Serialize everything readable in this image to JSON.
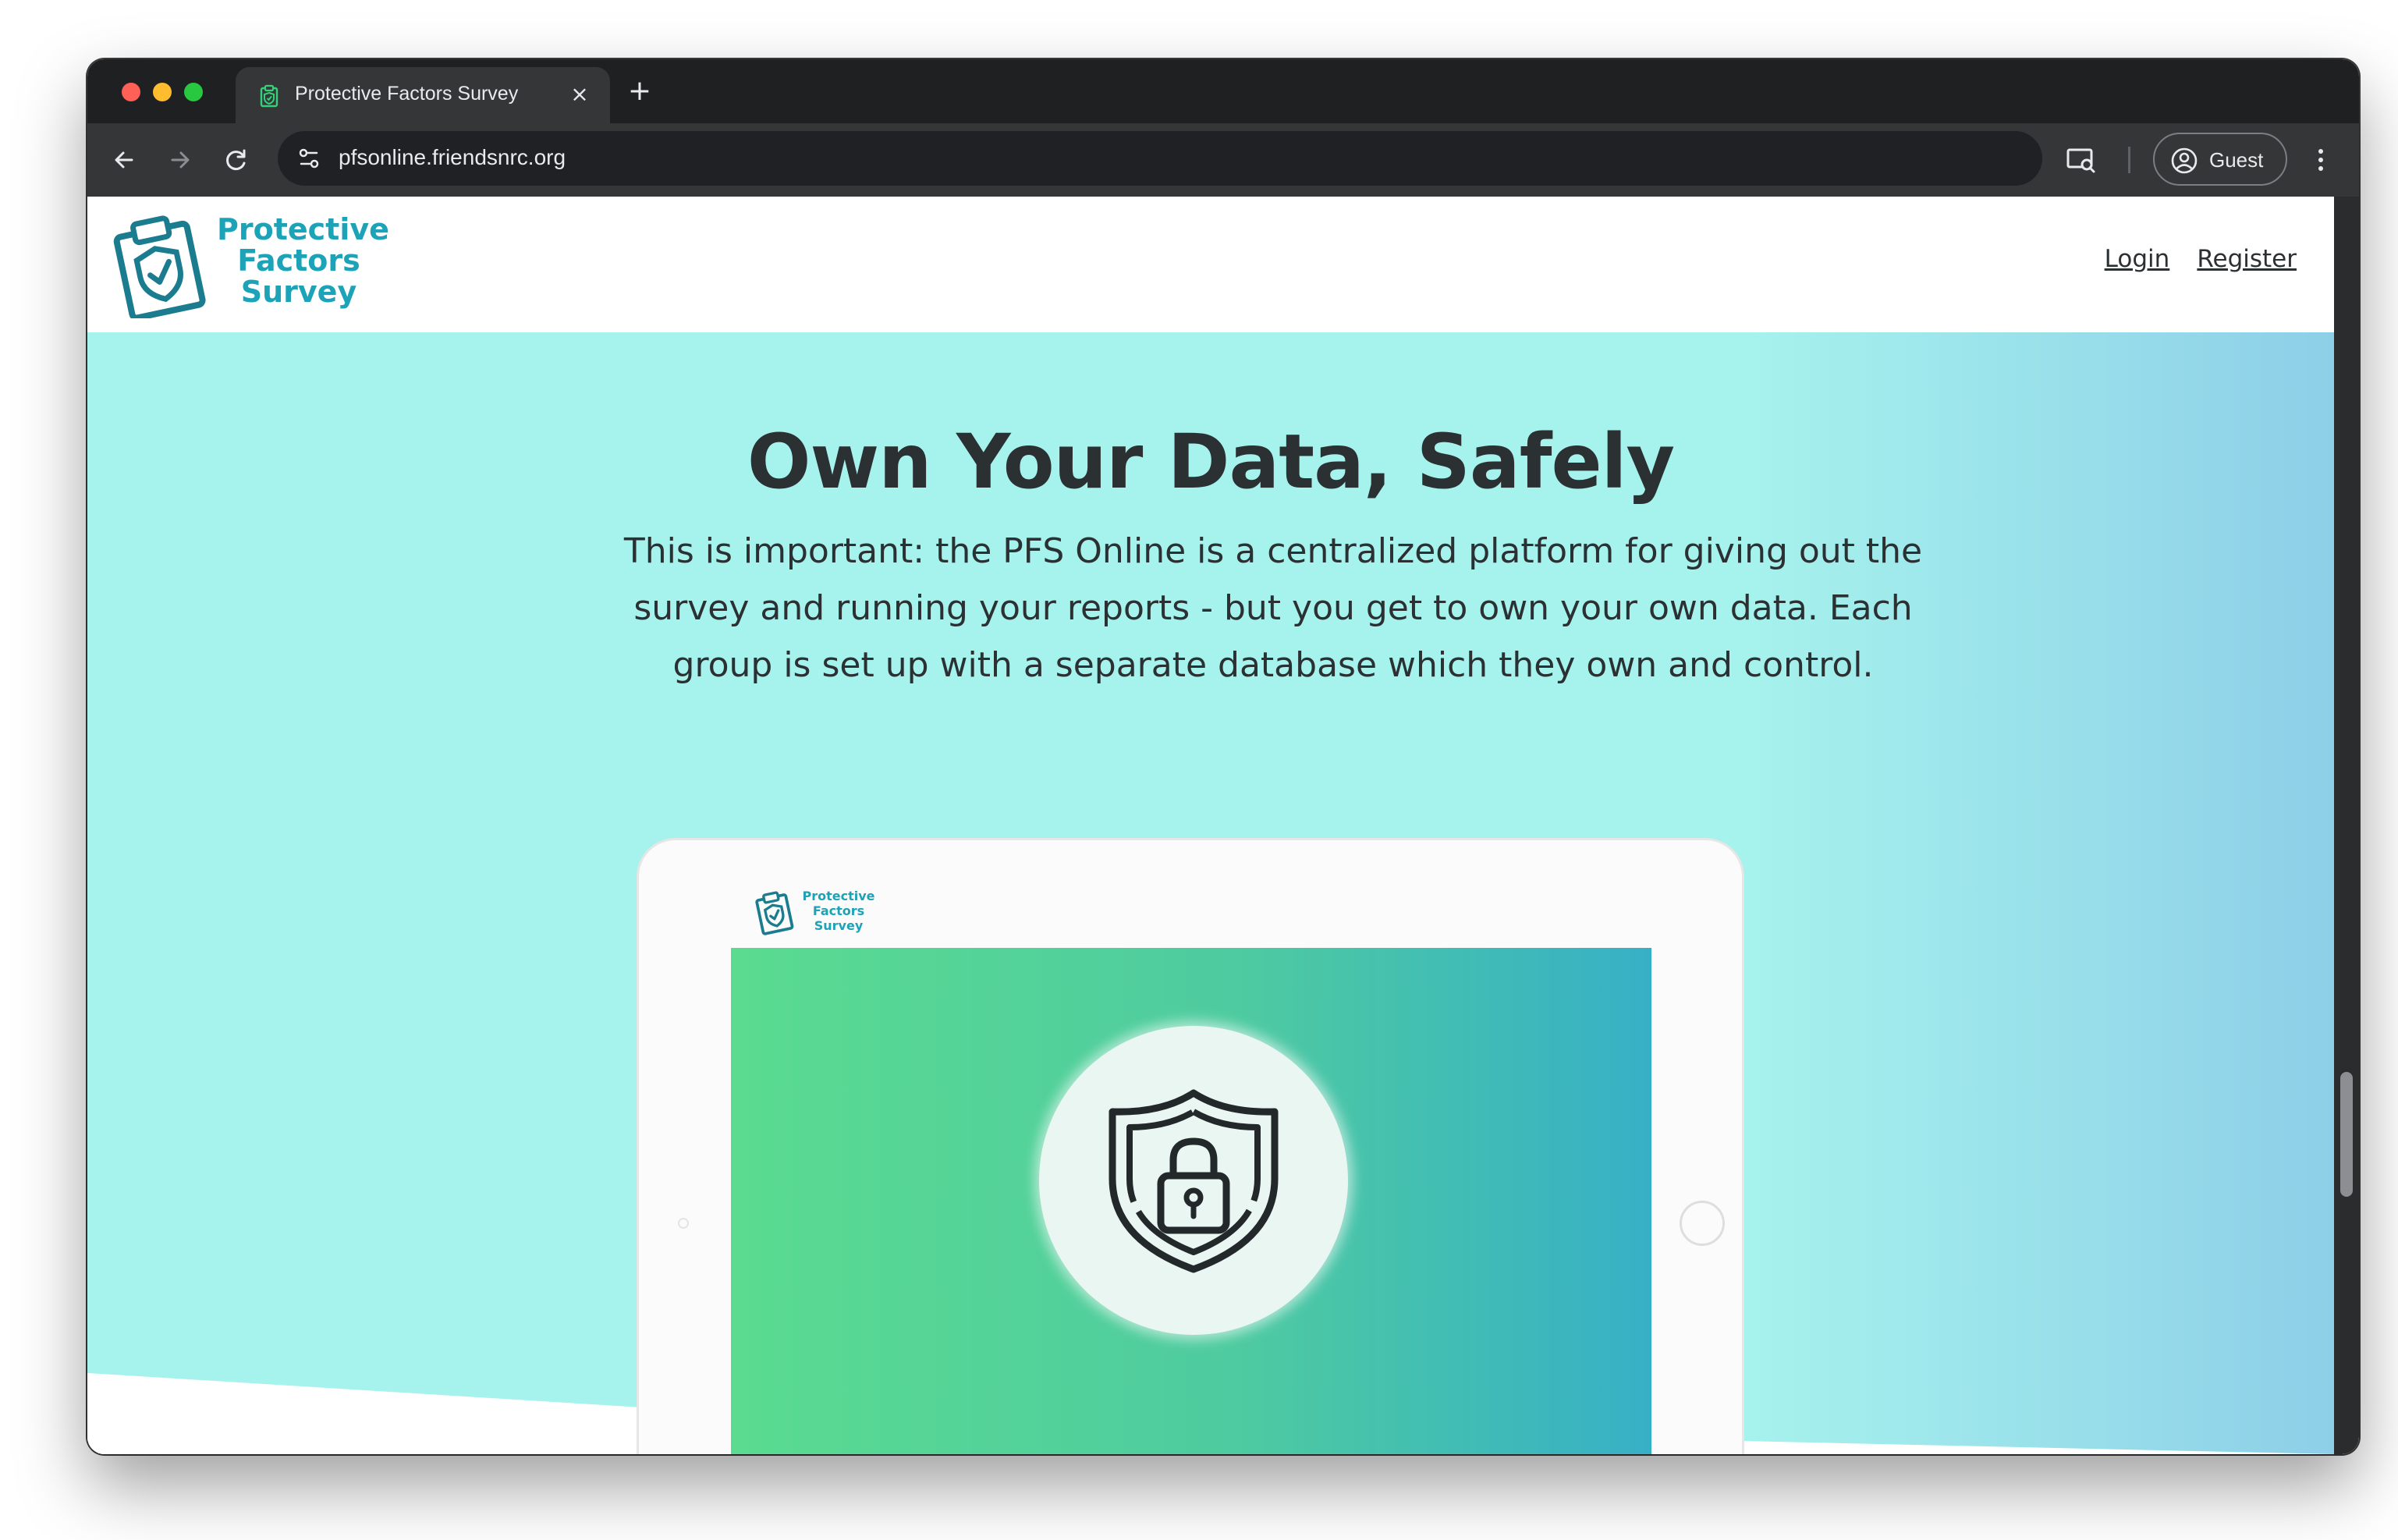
{
  "browser": {
    "tab_title": "Protective Factors Survey",
    "tab_close": "×",
    "new_tab": "+",
    "url": "pfsonline.friendsnrc.org",
    "profile_label": "Guest",
    "icons": {
      "back": "arrow-left-icon",
      "forward": "arrow-right-icon",
      "reload": "reload-icon",
      "site_info": "tune-icon",
      "cast": "cast-icon",
      "profile": "person-circle-icon",
      "menu": "vertical-dots-icon"
    }
  },
  "site": {
    "logo": {
      "line1": "Protective",
      "line2": "Factors",
      "line3": "Survey"
    },
    "nav": {
      "login": "Login",
      "register": "Register"
    }
  },
  "hero": {
    "title": "Own Your Data, Safely",
    "body": "This is important: the PFS Online is a centralized platform for giving out the survey and running your reports - but you get to own your own data. Each group is set up with a separate database which they own and control."
  },
  "tablet": {
    "logo": {
      "line1": "Protective",
      "line2": "Factors",
      "line3": "Survey"
    },
    "illustration": "shield-lock-icon"
  },
  "colors": {
    "brand_teal": "#1ca3b8",
    "hero_bg": "#a6f2ed",
    "text_dark": "#2b3033"
  }
}
